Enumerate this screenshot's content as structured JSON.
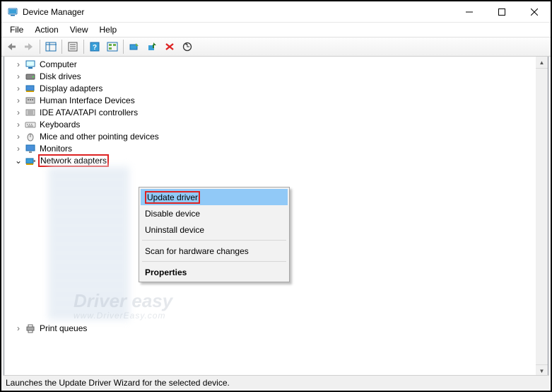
{
  "window": {
    "title": "Device Manager"
  },
  "menu": {
    "file": "File",
    "action": "Action",
    "view": "View",
    "help": "Help"
  },
  "tree": {
    "items": [
      {
        "label": "Computer"
      },
      {
        "label": "Disk drives"
      },
      {
        "label": "Display adapters"
      },
      {
        "label": "Human Interface Devices"
      },
      {
        "label": "IDE ATA/ATAPI controllers"
      },
      {
        "label": "Keyboards"
      },
      {
        "label": "Mice and other pointing devices"
      },
      {
        "label": "Monitors"
      },
      {
        "label": "Network adapters"
      },
      {
        "label": "Print queues"
      }
    ]
  },
  "context_menu": {
    "update": "Update driver",
    "disable": "Disable device",
    "uninstall": "Uninstall device",
    "scan": "Scan for hardware changes",
    "properties": "Properties"
  },
  "status": {
    "text": "Launches the Update Driver Wizard for the selected device."
  },
  "watermark": {
    "brand": "Driver easy",
    "url": "www.DriverEasy.com"
  }
}
